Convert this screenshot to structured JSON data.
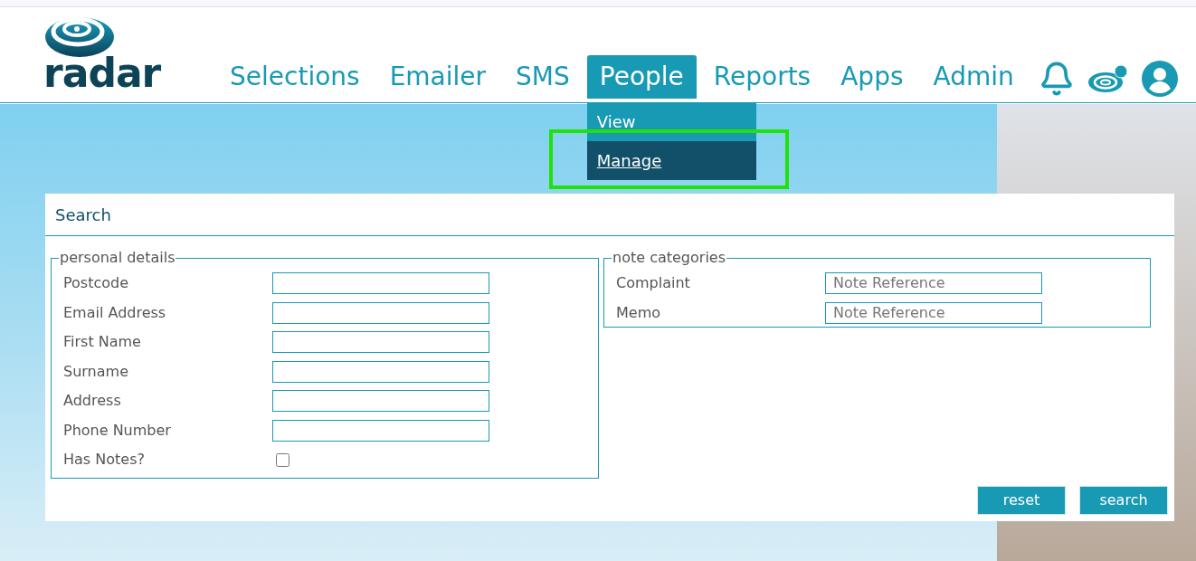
{
  "logo": {
    "text": "radar"
  },
  "nav": [
    {
      "label": "Selections",
      "selected": false
    },
    {
      "label": "Emailer",
      "selected": false
    },
    {
      "label": "SMS",
      "selected": false
    },
    {
      "label": "People",
      "selected": true,
      "menu": [
        {
          "label": "View",
          "selected": false
        },
        {
          "label": "Manage",
          "selected": true
        }
      ]
    },
    {
      "label": "Reports",
      "selected": false
    },
    {
      "label": "Apps",
      "selected": false
    },
    {
      "label": "Admin",
      "selected": false
    }
  ],
  "panel": {
    "title": "Search",
    "personal_details": {
      "legend": "personal details",
      "fields": [
        {
          "label": "Postcode",
          "kind": "text"
        },
        {
          "label": "Email Address",
          "kind": "text"
        },
        {
          "label": "First Name",
          "kind": "text"
        },
        {
          "label": "Surname",
          "kind": "text"
        },
        {
          "label": "Address",
          "kind": "text"
        },
        {
          "label": "Phone Number",
          "kind": "text"
        },
        {
          "label": "Has Notes?",
          "kind": "checkbox",
          "checked": false
        }
      ]
    },
    "note_categories": {
      "legend": "note categories",
      "fields": [
        {
          "label": "Complaint",
          "kind": "text",
          "placeholder": "Note Reference"
        },
        {
          "label": "Memo",
          "kind": "text",
          "placeholder": "Note Reference"
        }
      ]
    },
    "buttons": [
      "reset",
      "search"
    ]
  }
}
